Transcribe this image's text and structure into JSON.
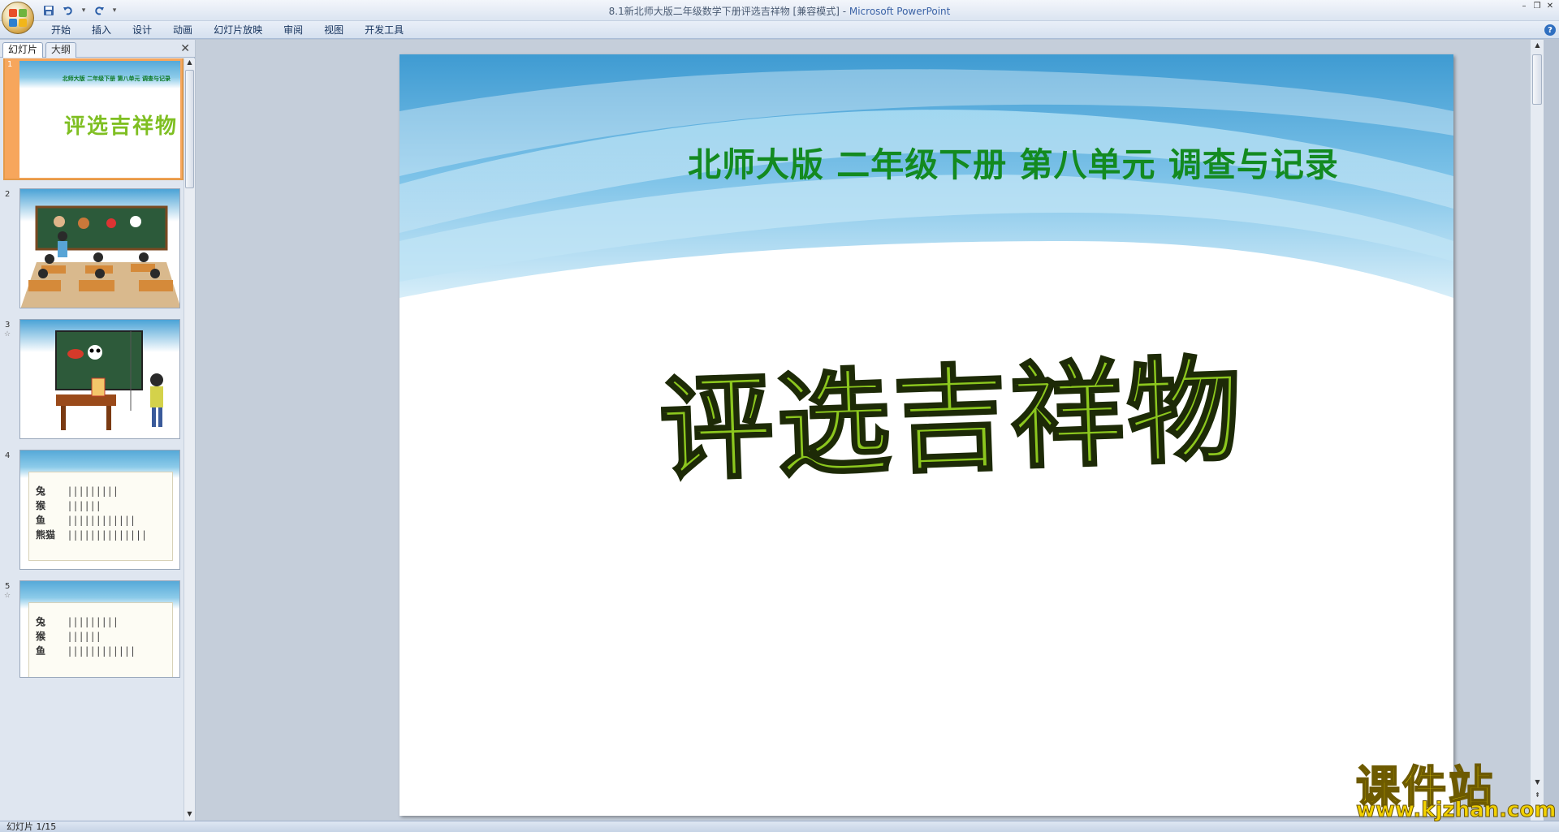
{
  "window": {
    "title_doc": "8.1新北师大版二年级数学下册评选吉祥物 [兼容模式] - ",
    "title_app": "Microsoft PowerPoint"
  },
  "ribbon": {
    "tabs": [
      "开始",
      "插入",
      "设计",
      "动画",
      "幻灯片放映",
      "审阅",
      "视图",
      "开发工具"
    ]
  },
  "panel": {
    "tab_slides": "幻灯片",
    "tab_outline": "大纲",
    "thumbnails": [
      {
        "num": "1",
        "header": "北师大版 二年级下册 第八单元 调查与记录",
        "title": "评选吉祥物"
      },
      {
        "num": "2"
      },
      {
        "num": "3"
      },
      {
        "num": "4",
        "rows": [
          "兔",
          "猴",
          "鱼",
          "熊猫"
        ]
      },
      {
        "num": "5",
        "rows": [
          "兔",
          "猴",
          "鱼"
        ]
      }
    ]
  },
  "slide": {
    "header": "北师大版  二年级下册  第八单元  调查与记录",
    "title": "评选吉祥物"
  },
  "status": {
    "slide_info": "幻灯片 1/15"
  },
  "watermark": {
    "text": "课件站",
    "url": "www.kjzhan.com"
  },
  "colors": {
    "header_green": "#138a20",
    "title_green": "#8cc71e",
    "sky_blue": "#4aa3d6",
    "selection_orange": "#f7a65c"
  }
}
